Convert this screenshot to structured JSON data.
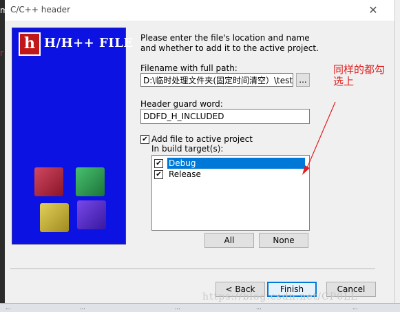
{
  "window": {
    "title": "C/C++ header",
    "close_icon": "close-icon",
    "side_letter": "m",
    "side_red_letter": "r"
  },
  "banner": {
    "logo_letter": "h",
    "title": "H/H++ FILE",
    "cube_colors": [
      "#b0283c",
      "#2c9c4c",
      "#c8b838",
      "#5a2cc8"
    ],
    "background_color": "#0c12e2"
  },
  "form": {
    "intro": "Please enter the file's location and name and whether to add it to the active project.",
    "filename_label": "Filename with full path:",
    "filename_value": "D:\\临时处理文件夹(固定时间清空）\\test",
    "browse_label": "...",
    "guard_label": "Header guard word:",
    "guard_value": "DDFD_H_INCLUDED",
    "add_file_label": "Add file to active project",
    "add_file_checked": true,
    "targets_label": "In build target(s):",
    "targets": [
      {
        "label": "Debug",
        "checked": true,
        "selected": true
      },
      {
        "label": "Release",
        "checked": true,
        "selected": false
      }
    ],
    "all_label": "All",
    "none_label": "None"
  },
  "buttons": {
    "back": "< Back",
    "finish": "Finish",
    "cancel": "Cancel"
  },
  "annotation": {
    "text": "同样的都勾选上",
    "color": "#e02020"
  },
  "watermark": "https://blog.csdn.net/CP0LL",
  "taskbar": {
    "tabs": [
      "...",
      "...",
      "...",
      "...",
      "..."
    ]
  }
}
